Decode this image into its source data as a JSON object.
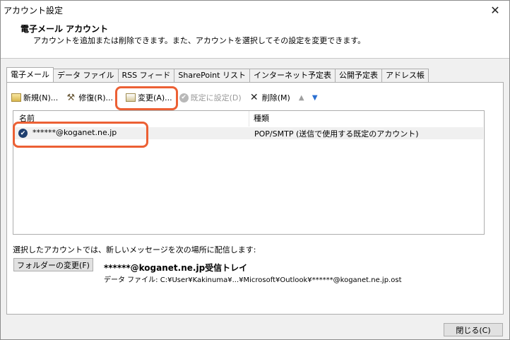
{
  "window": {
    "title": "アカウント設定"
  },
  "header": {
    "title": "電子メール アカウント",
    "subtitle": "アカウントを追加または削除できます。また、アカウントを選択してその設定を変更できます。"
  },
  "tabs": [
    "電子メール",
    "データ ファイル",
    "RSS フィード",
    "SharePoint リスト",
    "インターネット予定表",
    "公開予定表",
    "アドレス帳"
  ],
  "toolbar": {
    "new_label": "新規(N)...",
    "repair_label": "修復(R)...",
    "change_label": "変更(A)...",
    "default_label": "既定に設定(D)",
    "delete_label": "削除(M)"
  },
  "list": {
    "col_name": "名前",
    "col_type": "種類",
    "rows": [
      {
        "name": "******@koganet.ne.jp",
        "type": "POP/SMTP (送信で使用する既定のアカウント)"
      }
    ]
  },
  "delivery": {
    "label": "選択したアカウントでは、新しいメッセージを次の場所に配信します:",
    "folder_button": "フォルダーの変更(F)",
    "location": "******@koganet.ne.jp受信トレイ",
    "path": "データ ファイル: C:¥User¥Kakinuma¥...¥Microsoft¥Outlook¥******@koganet.ne.jp.ost"
  },
  "footer": {
    "close_label": "閉じる(C)"
  },
  "colors": {
    "highlight": "#ec6034",
    "default_check": "#1f3f6f",
    "arrow_down": "#2a6fd1"
  }
}
